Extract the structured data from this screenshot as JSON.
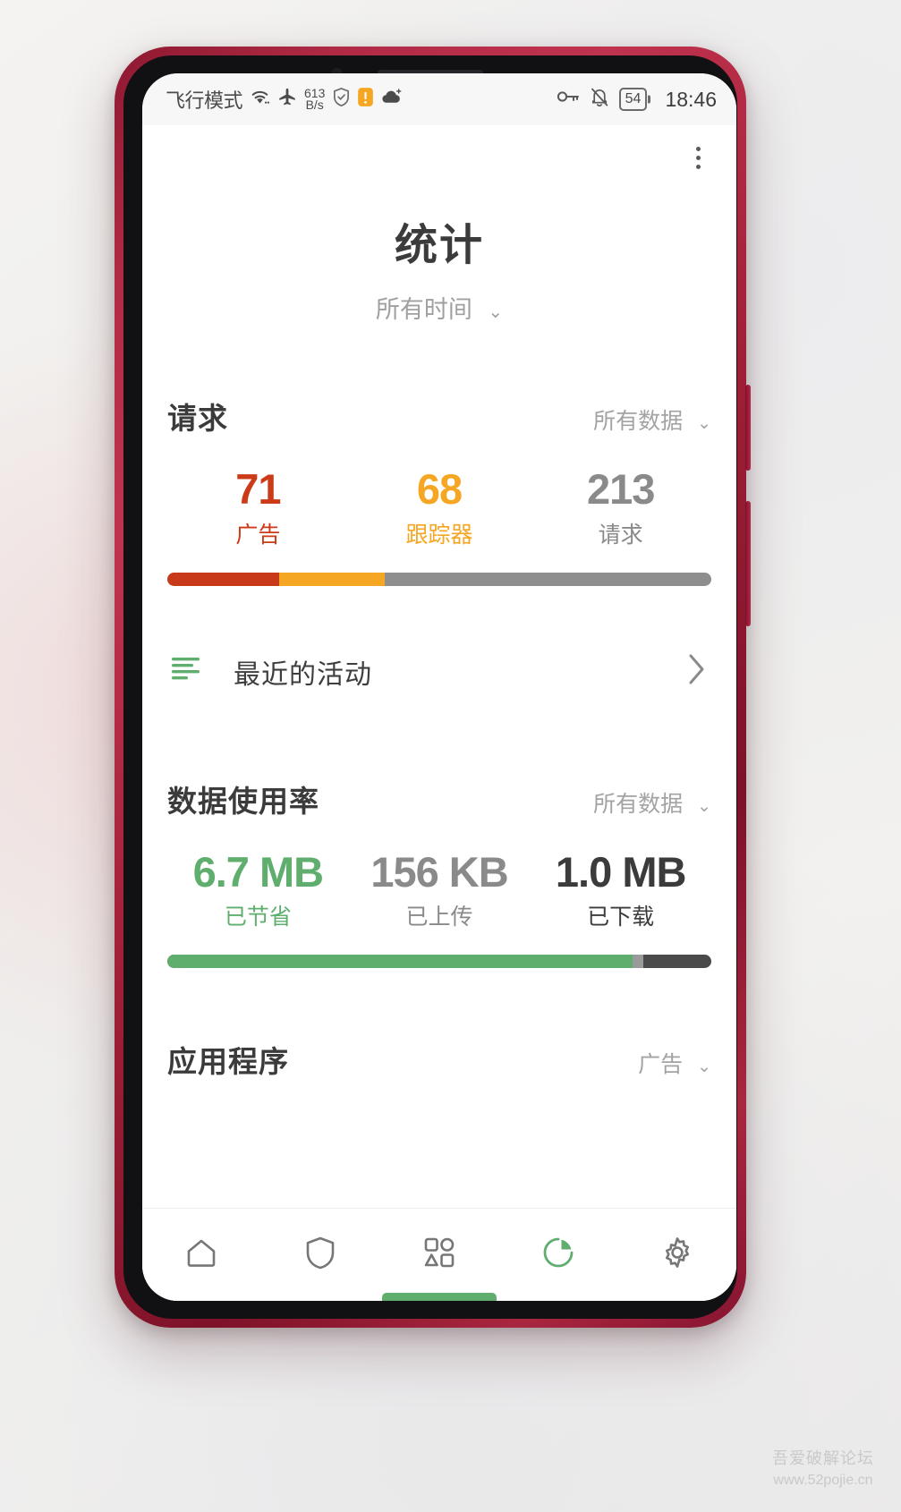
{
  "status_bar": {
    "carrier": "飞行模式",
    "net_speed_value": "613",
    "net_speed_unit": "B/s",
    "battery_level": "54",
    "time": "18:46",
    "icons": [
      "wifi-icon",
      "airplane-mode-icon",
      "shield-icon",
      "warning-badge-icon",
      "cloud-sync-icon",
      "key-icon",
      "bell-muted-icon",
      "battery-icon"
    ]
  },
  "header": {
    "title": "统计",
    "period_label": "所有时间",
    "caret": "⌄",
    "overflow_menu": "overflow-menu-icon"
  },
  "requests_section": {
    "title": "请求",
    "filter_label": "所有数据",
    "caret": "⌄",
    "stats": [
      {
        "value": "71",
        "label": "广告",
        "color": "#cc3b18"
      },
      {
        "value": "68",
        "label": "跟踪器",
        "color": "#f5a623"
      },
      {
        "value": "213",
        "label": "请求",
        "color": "#8a8a8a"
      }
    ],
    "bar": {
      "ads_pct": 20.5,
      "trackers_pct": 19.5,
      "remainder_color": "#8e8e8e",
      "ads_color": "#c8391a",
      "trackers_color": "#f5a623"
    }
  },
  "recent_activity": {
    "label": "最近的活动",
    "icon": "activity-list-icon",
    "chevron": "chevron-right-icon"
  },
  "data_usage_section": {
    "title": "数据使用率",
    "filter_label": "所有数据",
    "caret": "⌄",
    "stats": [
      {
        "value": "6.7 MB",
        "label": "已节省",
        "color": "#5fae6e"
      },
      {
        "value": "156 KB",
        "label": "已上传",
        "color": "#8a8a8a"
      },
      {
        "value": "1.0 MB",
        "label": "已下载",
        "color": "#3b3b3b"
      }
    ],
    "bar": {
      "saved_pct": 85.5,
      "uploaded_pct": 2.0,
      "saved_color": "#5fae6e",
      "uploaded_color": "#9a9a9a",
      "downloaded_color": "#4a4a4a"
    }
  },
  "apps_section": {
    "title": "应用程序",
    "filter_label": "广告",
    "caret": "⌄"
  },
  "bottom_nav": {
    "items": [
      {
        "name": "home",
        "icon": "home-icon",
        "active": false
      },
      {
        "name": "protection",
        "icon": "shield-icon",
        "active": false
      },
      {
        "name": "apps",
        "icon": "apps-grid-icon",
        "active": false
      },
      {
        "name": "statistics",
        "icon": "pie-chart-icon",
        "active": true
      },
      {
        "name": "settings",
        "icon": "gear-icon",
        "active": false
      }
    ],
    "active_color": "#5fae6e",
    "inactive_color": "#767676"
  },
  "watermark": {
    "title": "吾爱破解论坛",
    "url": "www.52pojie.cn"
  }
}
